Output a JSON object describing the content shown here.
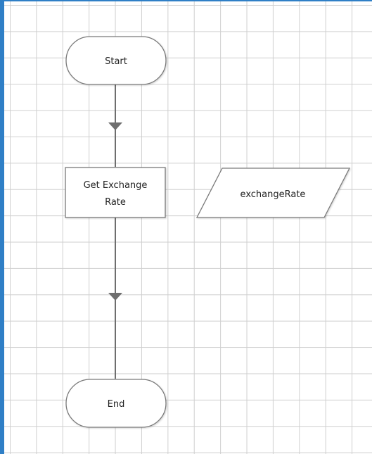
{
  "flowchart": {
    "nodes": {
      "start": {
        "label": "Start",
        "shape": "terminal"
      },
      "process": {
        "label_line1": "Get Exchange",
        "label_line2": "Rate",
        "shape": "process"
      },
      "data": {
        "label": "exchangeRate",
        "shape": "parallelogram"
      },
      "end": {
        "label": "End",
        "shape": "terminal"
      }
    },
    "edges": [
      {
        "from": "start",
        "to": "process"
      },
      {
        "from": "process",
        "to": "end"
      }
    ]
  },
  "colors": {
    "frame_accent": "#2f7fc6",
    "grid": "#cfcfcf",
    "shape_stroke": "#7a7a7a",
    "connector": "#6e6e6e"
  }
}
